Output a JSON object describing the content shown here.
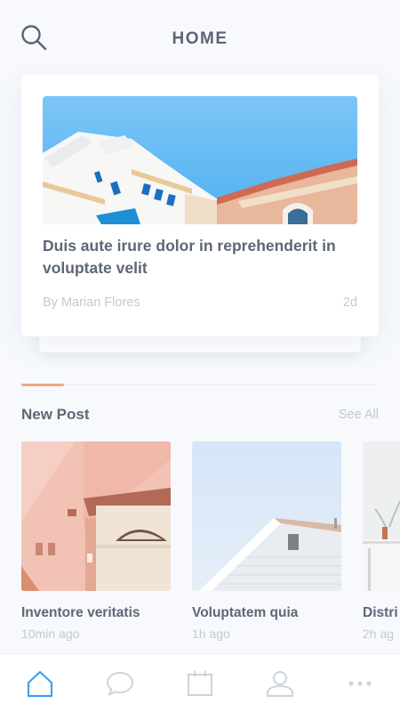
{
  "header": {
    "title": "HOME",
    "search_icon": "search-icon"
  },
  "featured": {
    "title": "Duis aute irure dolor in reprehenderit in voluptate velit",
    "author": "By Marian Flores",
    "age": "2d"
  },
  "pager": {
    "active_index": 0
  },
  "new_post": {
    "title": "New Post",
    "see_all": "See All",
    "items": [
      {
        "title": "Inventore veritatis",
        "time": "10min ago"
      },
      {
        "title": "Voluptatem quia",
        "time": "1h ago"
      },
      {
        "title": "Distri",
        "time": "2h ag"
      }
    ]
  },
  "tabbar": {
    "active": "home",
    "items": [
      {
        "name": "home",
        "icon": "home-icon"
      },
      {
        "name": "messages",
        "icon": "chat-bubble-icon"
      },
      {
        "name": "calendar",
        "icon": "calendar-icon"
      },
      {
        "name": "profile",
        "icon": "user-icon"
      },
      {
        "name": "more",
        "icon": "more-dots-icon"
      }
    ]
  },
  "colors": {
    "accent": "#3fa0ee",
    "pager_active": "#f2a488",
    "text": "#5d6777",
    "muted": "#c3c9d3",
    "tab_inactive": "#cdd3dc"
  }
}
